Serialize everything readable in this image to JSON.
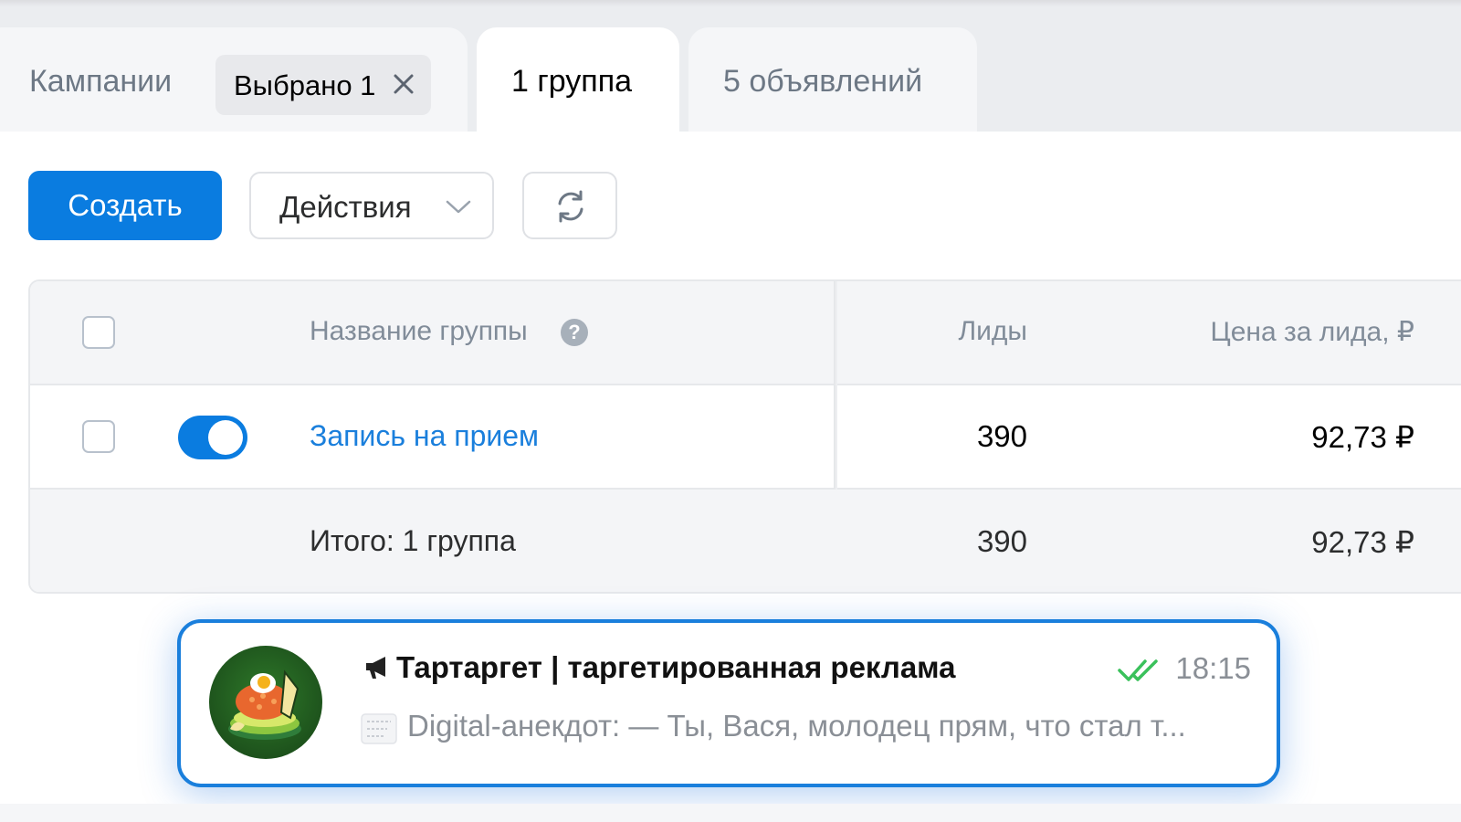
{
  "tabs": {
    "campaigns": {
      "label": "Кампании"
    },
    "selection_chip": {
      "label": "Выбрано 1"
    },
    "groups": {
      "label": "1 группа"
    },
    "ads": {
      "label": "5 объявлений"
    }
  },
  "toolbar": {
    "create_label": "Создать",
    "actions_label": "Действия"
  },
  "table": {
    "columns": {
      "name": "Название группы",
      "leads": "Лиды",
      "cost_per_lead": "Цена за лида, ₽"
    },
    "help_glyph": "?",
    "rows": [
      {
        "name": "Запись на прием",
        "leads": "390",
        "cost_per_lead": "92,73 ₽",
        "enabled": true
      }
    ],
    "total": {
      "label": "Итого: 1 группа",
      "leads": "390",
      "cost_per_lead": "92,73 ₽"
    }
  },
  "notification": {
    "title": "Тартаргет | таргетированная реклама",
    "time": "18:15",
    "preview": "Digital-анекдот: — Ты, Вася, молодец прям, что стал т...",
    "icons": [
      "megaphone-icon",
      "double-check-icon",
      "document-icon"
    ]
  },
  "colors": {
    "accent": "#0a7ce0",
    "link": "#1a7fdc",
    "check": "#3ac15b",
    "muted_text": "#818c99"
  }
}
